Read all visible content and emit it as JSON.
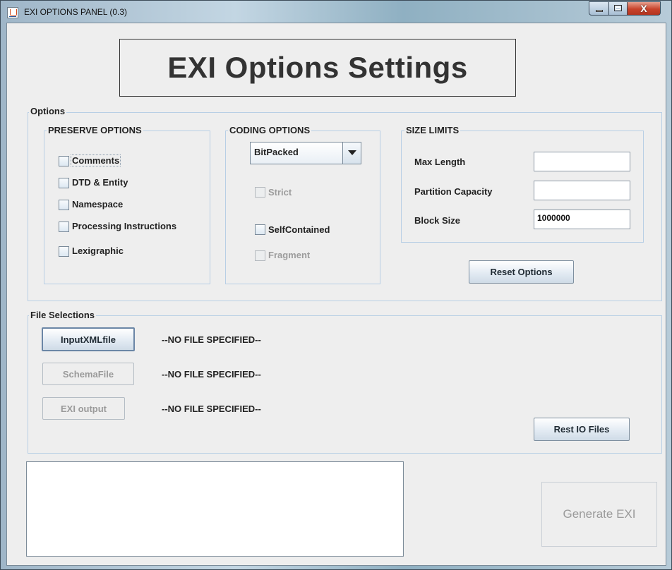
{
  "window": {
    "title": "EXI OPTIONS PANEL (0.3)",
    "close_glyph": "X"
  },
  "header": {
    "title": "EXI Options Settings"
  },
  "options": {
    "legend": "Options",
    "preserve": {
      "legend": "PRESERVE OPTIONS",
      "items": [
        {
          "label": "Comments",
          "checked": false
        },
        {
          "label": "DTD & Entity",
          "checked": false
        },
        {
          "label": "Namespace",
          "checked": false
        },
        {
          "label": "Processing Instructions",
          "checked": false
        },
        {
          "label": "Lexigraphic",
          "checked": false
        }
      ]
    },
    "coding": {
      "legend": "CODING OPTIONS",
      "selected": "BitPacked",
      "strict_label": "Strict",
      "selfcontained_label": "SelfContained",
      "fragment_label": "Fragment"
    },
    "size_limits": {
      "legend": "SIZE LIMITS",
      "max_length_label": "Max Length",
      "max_length_value": "",
      "partition_capacity_label": "Partition Capacity",
      "partition_capacity_value": "",
      "block_size_label": "Block Size",
      "block_size_value": "1000000"
    },
    "reset_label": "Reset Options"
  },
  "files": {
    "legend": "File Selections",
    "input_button": "InputXMLfile",
    "input_status": "--NO FILE SPECIFIED--",
    "schema_button": "SchemaFile",
    "schema_status": "--NO FILE SPECIFIED--",
    "output_button": "EXI output",
    "output_status": "--NO FILE SPECIFIED--",
    "reset_label": "Rest IO Files"
  },
  "footer": {
    "log_text": "",
    "generate_label": "Generate EXI"
  },
  "icons": {
    "app": "java-icon",
    "minimize": "minimize-icon",
    "maximize": "maximize-icon",
    "close": "close-icon",
    "dropdown": "chevron-down-icon"
  }
}
